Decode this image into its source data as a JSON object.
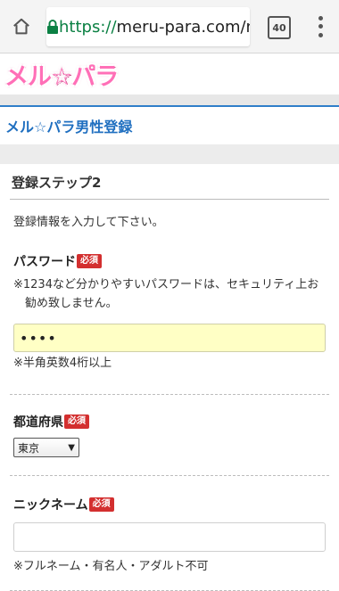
{
  "browser": {
    "url_scheme": "https://",
    "url_host": "meru-para.com/n",
    "tab_count": "40"
  },
  "site": {
    "logo_text": "メル☆パラ",
    "page_title": "メル☆パラ男性登録"
  },
  "form": {
    "step_title": "登録ステップ2",
    "lead_text": "登録情報を入力して下さい。",
    "required_badge": "必須",
    "password": {
      "label": "パスワード",
      "note_security": "※1234など分かりやすいパスワードは、セキュリティ上お勧め致しません。",
      "value": "••••",
      "hint": "※半角英数4桁以上"
    },
    "prefecture": {
      "label": "都道府県",
      "selected": "東京",
      "arrow": "▼"
    },
    "nickname": {
      "label": "ニックネーム",
      "value": "",
      "hint": "※フルネーム・有名人・アダルト不可"
    }
  },
  "colors": {
    "accent_blue": "#1f6fc0",
    "required_red": "#d32f2f",
    "password_fill": "#ffffc5"
  }
}
